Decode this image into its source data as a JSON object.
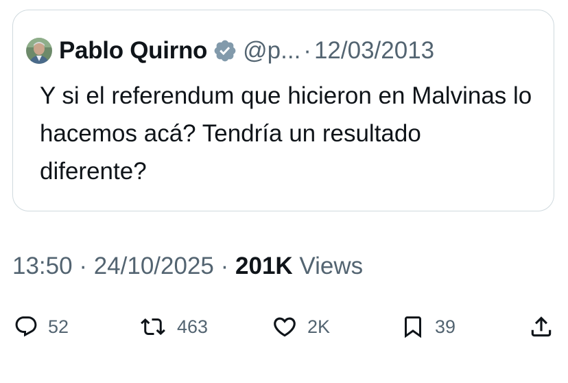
{
  "quoted_tweet": {
    "author_name": "Pablo Quirno",
    "handle": "@p...",
    "separator": "·",
    "date": "12/03/2013",
    "text": "Y si el referendum que hicieron en Malvinas lo hacemos acá? Tendría un resultado diferente?"
  },
  "meta": {
    "time": "13:50",
    "dot1": "·",
    "date": "24/10/2025",
    "dot2": "·",
    "views_count": "201K",
    "views_label": "Views"
  },
  "actions": {
    "reply_count": "52",
    "retweet_count": "463",
    "like_count": "2K",
    "bookmark_count": "39"
  },
  "icons": {
    "verified": "verified-badge-icon",
    "reply": "reply-icon",
    "retweet": "retweet-icon",
    "like": "heart-icon",
    "bookmark": "bookmark-icon",
    "share": "share-icon"
  },
  "colors": {
    "text": "#0f1419",
    "secondary": "#536471",
    "border": "#cfd9de",
    "verified_badge": "#829aab"
  }
}
